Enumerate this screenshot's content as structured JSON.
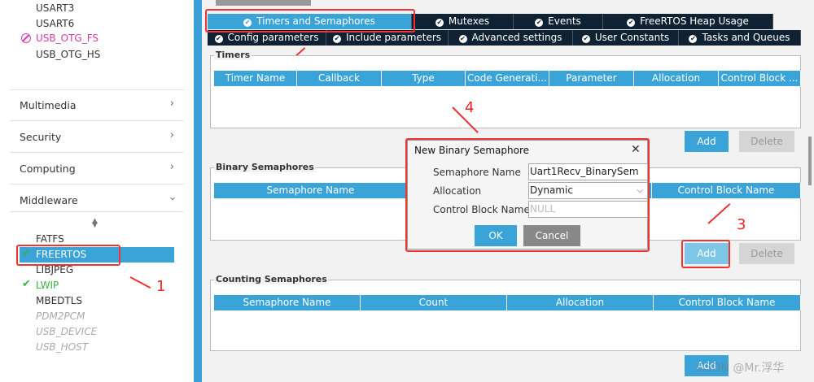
{
  "sidebar": {
    "usart3": "USART3",
    "usart6": "USART6",
    "usb_otg_fs": "USB_OTG_FS",
    "usb_otg_hs": "USB_OTG_HS",
    "categories": {
      "multimedia": "Multimedia",
      "security": "Security",
      "computing": "Computing",
      "middleware": "Middleware"
    },
    "middleware_items": {
      "fatfs": "FATFS",
      "freertos": "FREERTOS",
      "libjpeg": "LIBJPEG",
      "lwip": "LWIP",
      "mbedtls": "MBEDTLS",
      "pdm2pcm": "PDM2PCM",
      "usb_device": "USB_DEVICE",
      "usb_host": "USB_HOST"
    }
  },
  "tabs_row1": {
    "timers_semaphores": "Timers and Semaphores",
    "mutexes": "Mutexes",
    "events": "Events",
    "heap_usage": "FreeRTOS Heap Usage"
  },
  "tabs_row2": {
    "config": "Config parameters",
    "include": "Include parameters",
    "advanced": "Advanced settings",
    "user_constants": "User Constants",
    "tasks_queues": "Tasks and Queues"
  },
  "timers": {
    "title": "Timers",
    "columns": [
      "Timer Name",
      "Callback",
      "Type",
      "Code Generati...",
      "Parameter",
      "Allocation",
      "Control Block ..."
    ]
  },
  "binary": {
    "title": "Binary Semaphores",
    "col_name": "Semaphore Name",
    "col_cb": "Control Block Name"
  },
  "counting": {
    "title": "Counting Semaphores",
    "columns": [
      "Semaphore Name",
      "Count",
      "Allocation",
      "Control Block Name"
    ]
  },
  "buttons": {
    "add": "Add",
    "delete": "Delete"
  },
  "dialog": {
    "title": "New Binary Semaphore",
    "close": "✕",
    "name_label": "Semaphore Name",
    "name_value": "Uart1Recv_BinarySem",
    "alloc_label": "Allocation",
    "alloc_value": "Dynamic",
    "cb_label": "Control Block Name",
    "cb_placeholder": "NULL",
    "ok": "OK",
    "cancel": "Cancel"
  },
  "annotations": {
    "a1": "1",
    "a2": "2",
    "a3": "3",
    "a4": "4"
  },
  "watermark": "CSDN @Mr.浮华",
  "colors": {
    "accent": "#3aa3d8",
    "tab_dark": "#0e2233",
    "annotation_red": "#e33333",
    "check_green": "#3cb043"
  }
}
